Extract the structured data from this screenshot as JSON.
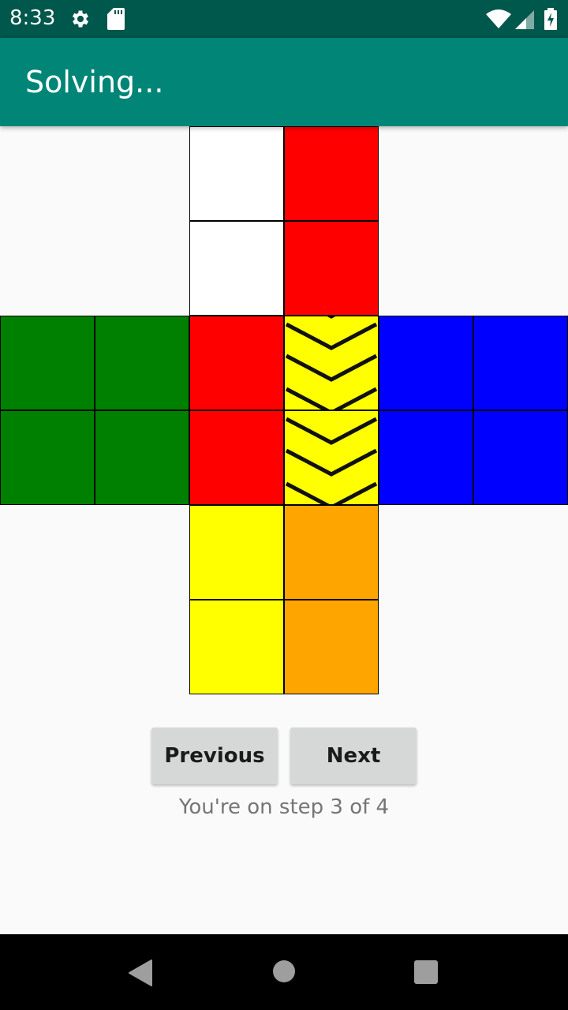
{
  "status_bar": {
    "time": "8:33",
    "icons": [
      "gear-icon",
      "sd-card-icon",
      "wifi-icon",
      "signal-icon",
      "battery-charging-icon"
    ]
  },
  "app_bar": {
    "title": "Solving..."
  },
  "cube": {
    "colors": {
      "white": "#ffffff",
      "red": "#ff0000",
      "green": "#008000",
      "yellow": "#ffff00",
      "blue": "#0000ff",
      "orange": "#ffa500"
    },
    "faces": {
      "top": [
        [
          "white",
          "red"
        ],
        [
          "white",
          "red"
        ]
      ],
      "left": [
        [
          "green",
          "green"
        ],
        [
          "green",
          "green"
        ]
      ],
      "front": [
        [
          "red",
          "yellow"
        ],
        [
          "red",
          "yellow"
        ]
      ],
      "right": [
        [
          "blue",
          "blue"
        ],
        [
          "blue",
          "blue"
        ]
      ],
      "bottom": [
        [
          "yellow",
          "orange"
        ],
        [
          "yellow",
          "orange"
        ]
      ]
    },
    "move_indicator": {
      "face": "front",
      "column": 1,
      "direction": "down"
    }
  },
  "controls": {
    "previous_label": "Previous",
    "next_label": "Next",
    "step_text": "You're on step 3 of 4",
    "current_step": 3,
    "total_steps": 4
  },
  "nav_bar": {
    "icons": [
      "back-icon",
      "home-icon",
      "recents-icon"
    ]
  }
}
